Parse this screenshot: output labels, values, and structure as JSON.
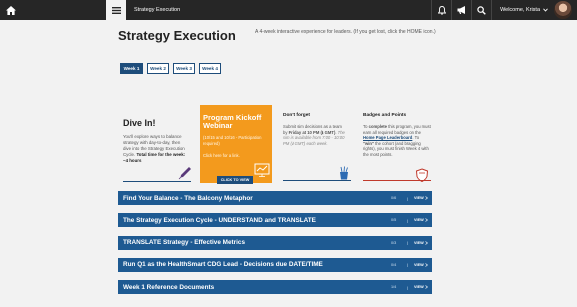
{
  "app": {
    "title": "Strategy Execution"
  },
  "topbar": {
    "welcome": "Welcome, Krista"
  },
  "header": {
    "title": "Strategy Execution",
    "intro": "A 4-week interactive experience for leaders. (If you get lost, click the HOME icon.)"
  },
  "weeks": [
    {
      "label": "Week 1"
    },
    {
      "label": "Week 2"
    },
    {
      "label": "Week 3"
    },
    {
      "label": "Week 4"
    }
  ],
  "dive": {
    "title": "Dive In!",
    "text": "You'll explore ways to balance strategy with day-to-day, then dive into the Strategy Execution Cycle.",
    "time_label": "Total time for the week: ~4 hours"
  },
  "kickoff": {
    "title": "Program Kickoff Webinar",
    "text": "(10/15 and 10/16 - Participation required)",
    "link": "Click here for a link.",
    "button": "CLICK TO VIEW"
  },
  "forget": {
    "title": "Don't forget",
    "text_pre": "Submit sim decisions as a team by",
    "text_bold": "Friday at 10 PM (ℹ GMT)",
    "text_italic": "The sim is available from 7:00 - 10:00 PM (ℹ GMT) each week."
  },
  "badges": {
    "title": "Badges and Points",
    "text_pre": "To",
    "text_bold1": "complete",
    "text_mid": "this program, you must earn all required badges on the",
    "link": "Home Page Leaderboard",
    "text_to": ". To",
    "text_bold2": "\"win\"",
    "text_end": "the cohort (and bragging rights), you must finish Week 4 with the most points."
  },
  "modules": [
    {
      "title": "Find Your Balance - The Balcony Metaphor",
      "count": "0/6",
      "view": "VIEW"
    },
    {
      "title": "The Strategy Execution Cycle - UNDERSTAND and TRANSLATE",
      "count": "0/5",
      "view": "VIEW"
    },
    {
      "title": "TRANSLATE Strategy - Effective Metrics",
      "count": "0/3",
      "view": "VIEW"
    },
    {
      "title": "Run Q1 as the HealthSmart CDG Lead - Decisions due DATE/TIME",
      "count": "0/4",
      "view": "VIEW"
    },
    {
      "title": "Week 1 Reference Documents",
      "count": "1/4",
      "view": "VIEW"
    }
  ],
  "module_sep": "|",
  "colors": {
    "topbar": "#262626",
    "accent": "#1e5a92",
    "orange": "#f39a1d",
    "badge_red": "#c0392b"
  },
  "icons": [
    "home-icon",
    "menu-icon",
    "bell-icon",
    "megaphone-icon",
    "search-icon",
    "chevron-down-icon",
    "pen-icon",
    "chart-icon",
    "pencil-cup-icon",
    "shield-icon",
    "chevron-right-icon"
  ]
}
